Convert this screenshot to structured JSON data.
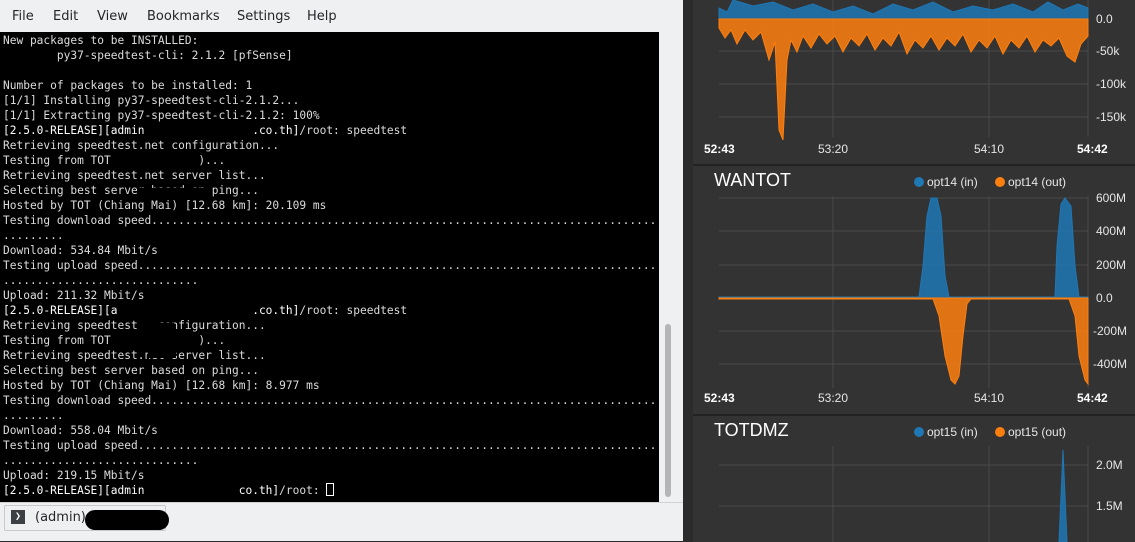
{
  "menubar": {
    "items": [
      "File",
      "Edit",
      "View",
      "Bookmarks",
      "Settings",
      "Help"
    ]
  },
  "terminal": {
    "lines": [
      [
        "New packages to be INSTALLED:"
      ],
      [
        "        py37-speedtest-cli: 2.1.2 [pfSense]"
      ],
      [
        ""
      ],
      [
        "Number of packages to be installed: 1"
      ],
      [
        "[1/1] Installing py37-speedtest-cli-2.1.2..."
      ],
      [
        "[1/1] Extracting py37-speedtest-cli-2.1.2: 100%"
      ],
      [
        {
          "w": "[2.5.0-RELEASE][admin                .co.th]"
        },
        "/root: speedtest"
      ],
      [
        "Retrieving speedtest.net configuration..."
      ],
      [
        "Testing from TOT             )..."
      ],
      [
        "Retrieving speedtest.net server list..."
      ],
      [
        "Selecting best server based on ping..."
      ],
      [
        "Hosted by TOT (Chiang Mai) [12.68 km]: 20.109 ms"
      ],
      [
        "Testing download speed................................................................................"
      ],
      [
        "........."
      ],
      [
        "Download: 534.84 Mbit/s"
      ],
      [
        "Testing upload speed.................................................................................."
      ],
      [
        "............................."
      ],
      [
        "Upload: 211.32 Mbit/s"
      ],
      [
        {
          "w": "[2.5.0-RELEASE][a                    .co.th]"
        },
        "/root: speedtest"
      ],
      [
        "Retrieving speedtest   configuration..."
      ],
      [
        "Testing from TOT             )..."
      ],
      [
        "Retrieving speedtest.net server list..."
      ],
      [
        "Selecting best server based on ping..."
      ],
      [
        "Hosted by TOT (Chiang Mai) [12.68 km]: 8.977 ms"
      ],
      [
        "Testing download speed................................................................................"
      ],
      [
        "........."
      ],
      [
        "Download: 558.04 Mbit/s"
      ],
      [
        "Testing upload speed.................................................................................."
      ],
      [
        "............................."
      ],
      [
        "Upload: 219.15 Mbit/s"
      ],
      [
        {
          "w": "[2.5.0-RELEASE][admin              co.th]"
        },
        "/root: "
      ]
    ]
  },
  "tabbar": {
    "session_label": "(admin)"
  },
  "dashboard": {
    "colors": {
      "in": "#1f77b4",
      "out": "#ff7f0e",
      "grid": "#4a4a4a",
      "background": "#333333"
    },
    "panels": [
      {
        "title": "",
        "legend": [],
        "y_labels": [
          "0.0",
          "-50k",
          "-100k",
          "-150k"
        ],
        "x_labels": [
          "52:43",
          "53:20",
          "54:10",
          "54:42"
        ]
      },
      {
        "title": "WANTOT",
        "legend": [
          {
            "label": "opt14 (in)",
            "color": "#1f77b4"
          },
          {
            "label": "opt14 (out)",
            "color": "#ff7f0e"
          }
        ],
        "y_labels": [
          "600M",
          "400M",
          "200M",
          "0.0",
          "-200M",
          "-400M"
        ],
        "x_labels": [
          "52:43",
          "53:20",
          "54:10",
          "54:42"
        ]
      },
      {
        "title": "TOTDMZ",
        "legend": [
          {
            "label": "opt15 (in)",
            "color": "#1f77b4"
          },
          {
            "label": "opt15 (out)",
            "color": "#ff7f0e"
          }
        ],
        "y_labels": [
          "2.0M",
          "1.5M"
        ],
        "x_labels": []
      }
    ]
  }
}
